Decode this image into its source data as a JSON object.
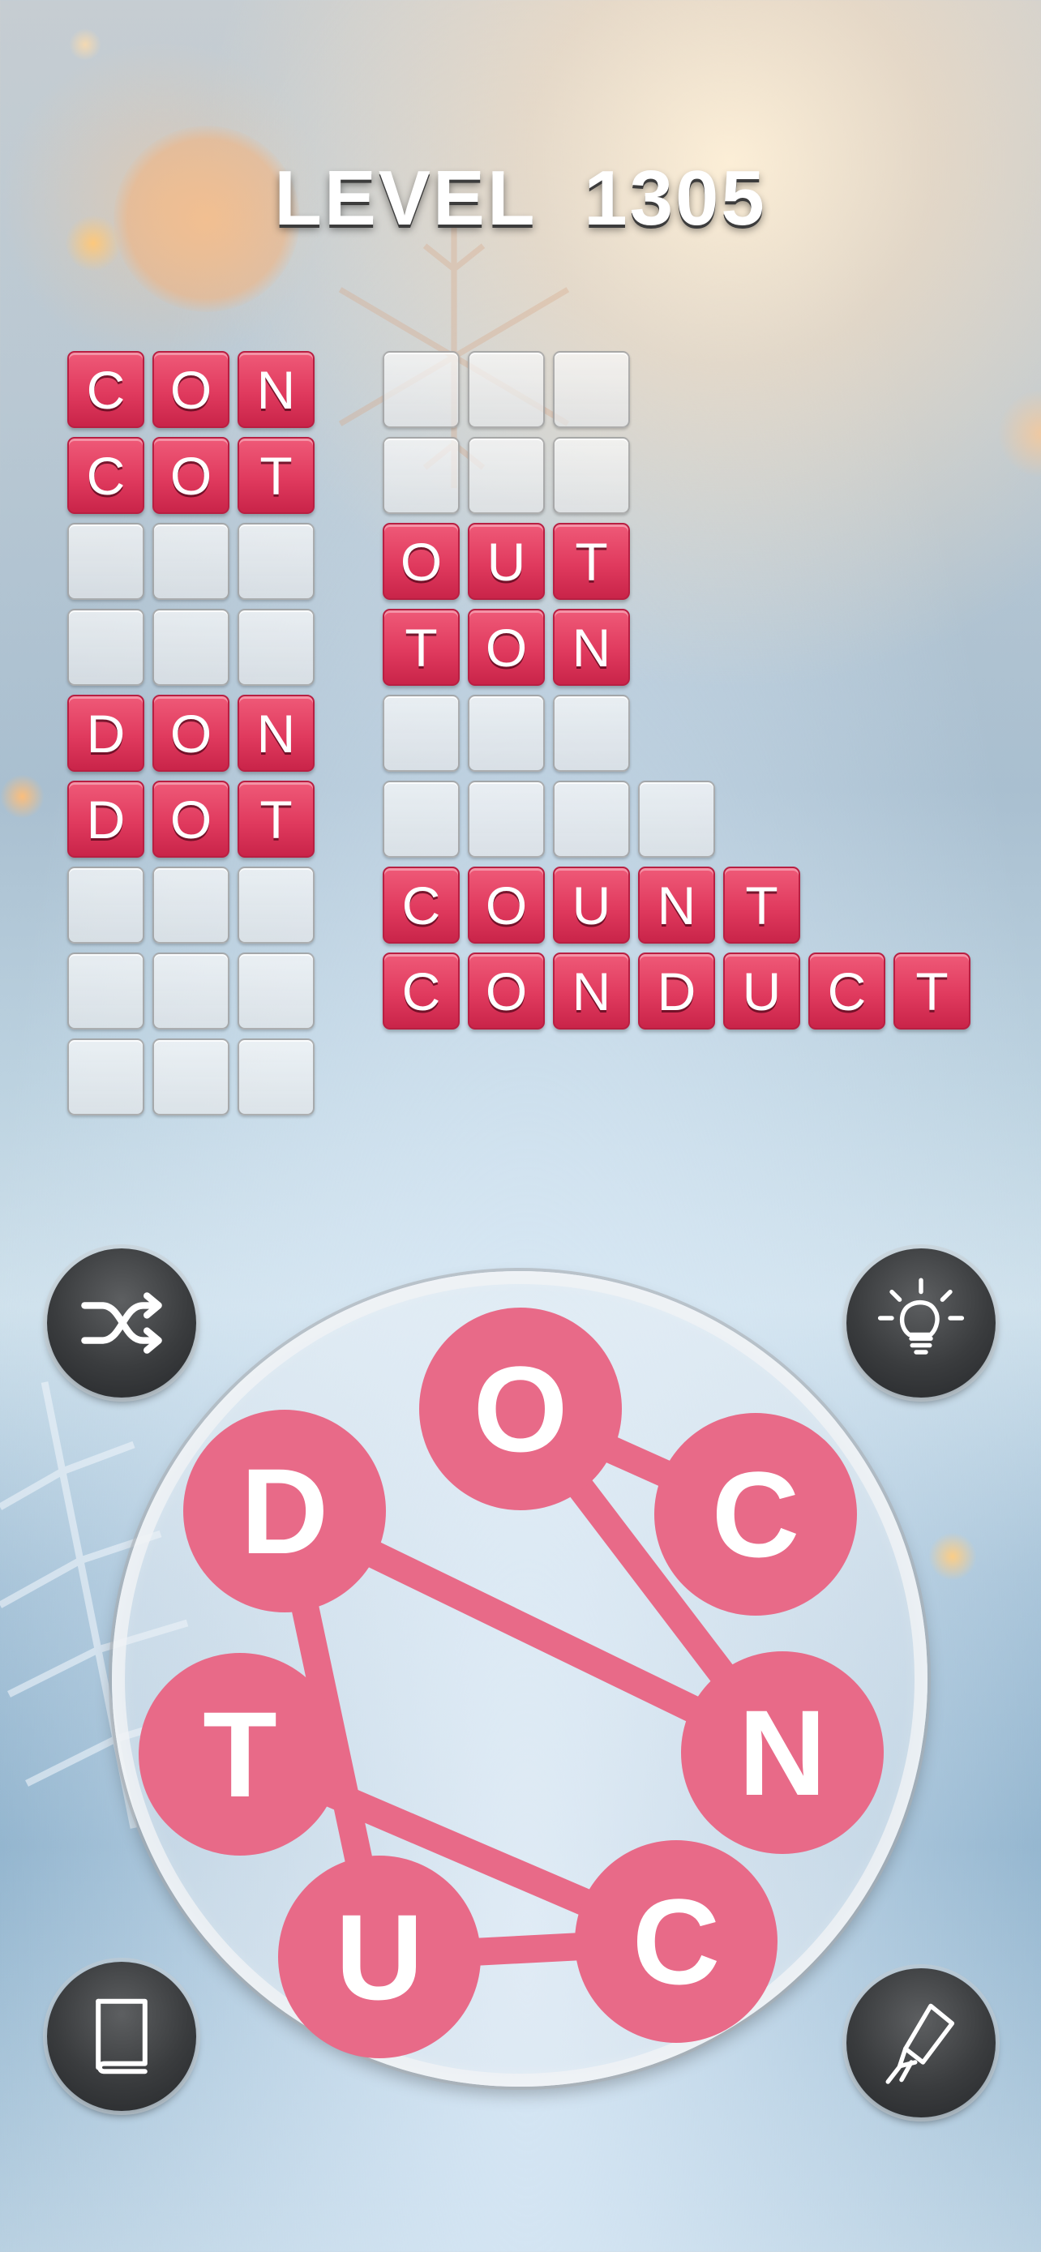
{
  "level": {
    "label": "LEVEL",
    "number": "1305"
  },
  "grid": {
    "left_column": [
      {
        "word": "CON",
        "letters": [
          "C",
          "O",
          "N"
        ],
        "solved": true
      },
      {
        "word": "COT",
        "letters": [
          "C",
          "O",
          "T"
        ],
        "solved": true
      },
      {
        "word": "",
        "letters": [
          "",
          "",
          ""
        ],
        "solved": false
      },
      {
        "word": "",
        "letters": [
          "",
          "",
          ""
        ],
        "solved": false
      },
      {
        "word": "DON",
        "letters": [
          "D",
          "O",
          "N"
        ],
        "solved": true
      },
      {
        "word": "DOT",
        "letters": [
          "D",
          "O",
          "T"
        ],
        "solved": true
      },
      {
        "word": "",
        "letters": [
          "",
          "",
          ""
        ],
        "solved": false
      },
      {
        "word": "",
        "letters": [
          "",
          "",
          ""
        ],
        "solved": false
      },
      {
        "word": "",
        "letters": [
          "",
          "",
          ""
        ],
        "solved": false
      }
    ],
    "right_column": [
      {
        "word": "",
        "letters": [
          "",
          "",
          ""
        ],
        "solved": false
      },
      {
        "word": "",
        "letters": [
          "",
          "",
          ""
        ],
        "solved": false
      },
      {
        "word": "OUT",
        "letters": [
          "O",
          "U",
          "T"
        ],
        "solved": true
      },
      {
        "word": "TON",
        "letters": [
          "T",
          "O",
          "N"
        ],
        "solved": true
      },
      {
        "word": "",
        "letters": [
          "",
          "",
          ""
        ],
        "solved": false
      },
      {
        "word": "",
        "letters": [
          "",
          "",
          "",
          ""
        ],
        "solved": false
      },
      {
        "word": "COUNT",
        "letters": [
          "C",
          "O",
          "U",
          "N",
          "T"
        ],
        "solved": true
      },
      {
        "word": "CONDUCT",
        "letters": [
          "C",
          "O",
          "N",
          "D",
          "U",
          "C",
          "T"
        ],
        "solved": true
      }
    ]
  },
  "wheel": {
    "letters": [
      "O",
      "C",
      "N",
      "C",
      "U",
      "T",
      "D"
    ],
    "connections": [
      [
        "O",
        "C1"
      ],
      [
        "O",
        "N"
      ],
      [
        "D",
        "N"
      ],
      [
        "D",
        "U"
      ],
      [
        "T",
        "C2"
      ],
      [
        "U",
        "C2"
      ]
    ],
    "letter_color": "#e86a88"
  },
  "buttons": {
    "shuffle": {
      "icon": "shuffle-icon"
    },
    "hint": {
      "icon": "lightbulb-icon"
    },
    "dictionary": {
      "icon": "book-icon"
    },
    "firework": {
      "icon": "rocket-icon"
    }
  },
  "colors": {
    "tile_filled": "#e03a5e",
    "tile_empty": "#ececec",
    "button_dark": "#3a3c3e"
  }
}
